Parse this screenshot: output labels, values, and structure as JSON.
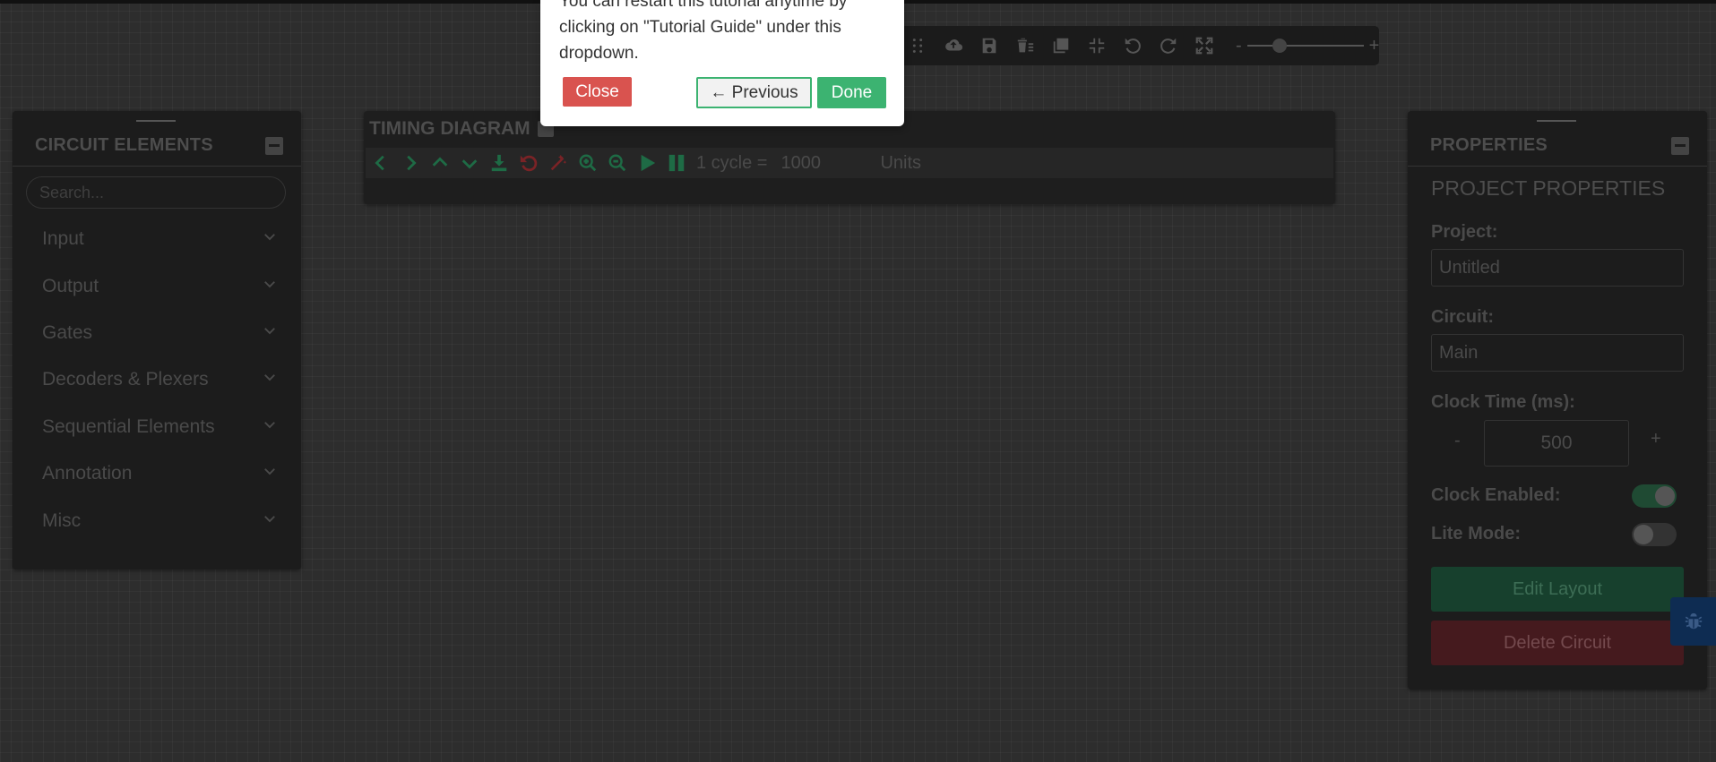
{
  "toolbar": {
    "icons": [
      "drag-handle-icon",
      "cloud-upload-icon",
      "save-icon",
      "delete-all-icon",
      "copy-icon",
      "fit-screen-icon",
      "undo-icon",
      "redo-icon",
      "fullscreen-icon"
    ],
    "zoom": {
      "minus": "-",
      "plus": "+",
      "level": 0.2
    }
  },
  "tutorial": {
    "text": "You can restart this tutorial anytime by clicking on \"Tutorial Guide\" under this dropdown.",
    "close_label": "Close",
    "previous_label": "← Previous",
    "done_label": "Done"
  },
  "circuit_elements": {
    "title": "CIRCUIT ELEMENTS",
    "search_placeholder": "Search...",
    "items": [
      {
        "label": "Input"
      },
      {
        "label": "Output"
      },
      {
        "label": "Gates"
      },
      {
        "label": "Decoders & Plexers"
      },
      {
        "label": "Sequential Elements"
      },
      {
        "label": "Annotation"
      },
      {
        "label": "Misc"
      }
    ]
  },
  "timing_diagram": {
    "title": "TIMING DIAGRAM",
    "cycle_label": "1 cycle =",
    "cycle_value": "1000",
    "units_label": "Units"
  },
  "properties": {
    "title": "PROPERTIES",
    "section": "PROJECT PROPERTIES",
    "project_label": "Project:",
    "project_value": "Untitled",
    "circuit_label": "Circuit:",
    "circuit_value": "Main",
    "clock_time_label": "Clock Time (ms):",
    "clock_minus": "-",
    "clock_value": "500",
    "clock_plus": "+",
    "clock_enabled_label": "Clock Enabled:",
    "clock_enabled": true,
    "lite_mode_label": "Lite Mode:",
    "lite_mode": false,
    "edit_layout_label": "Edit Layout",
    "delete_circuit_label": "Delete Circuit"
  },
  "colors": {
    "accent_green": "#3cb371",
    "danger_red": "#d9534f",
    "background": "#2d2d2d"
  }
}
